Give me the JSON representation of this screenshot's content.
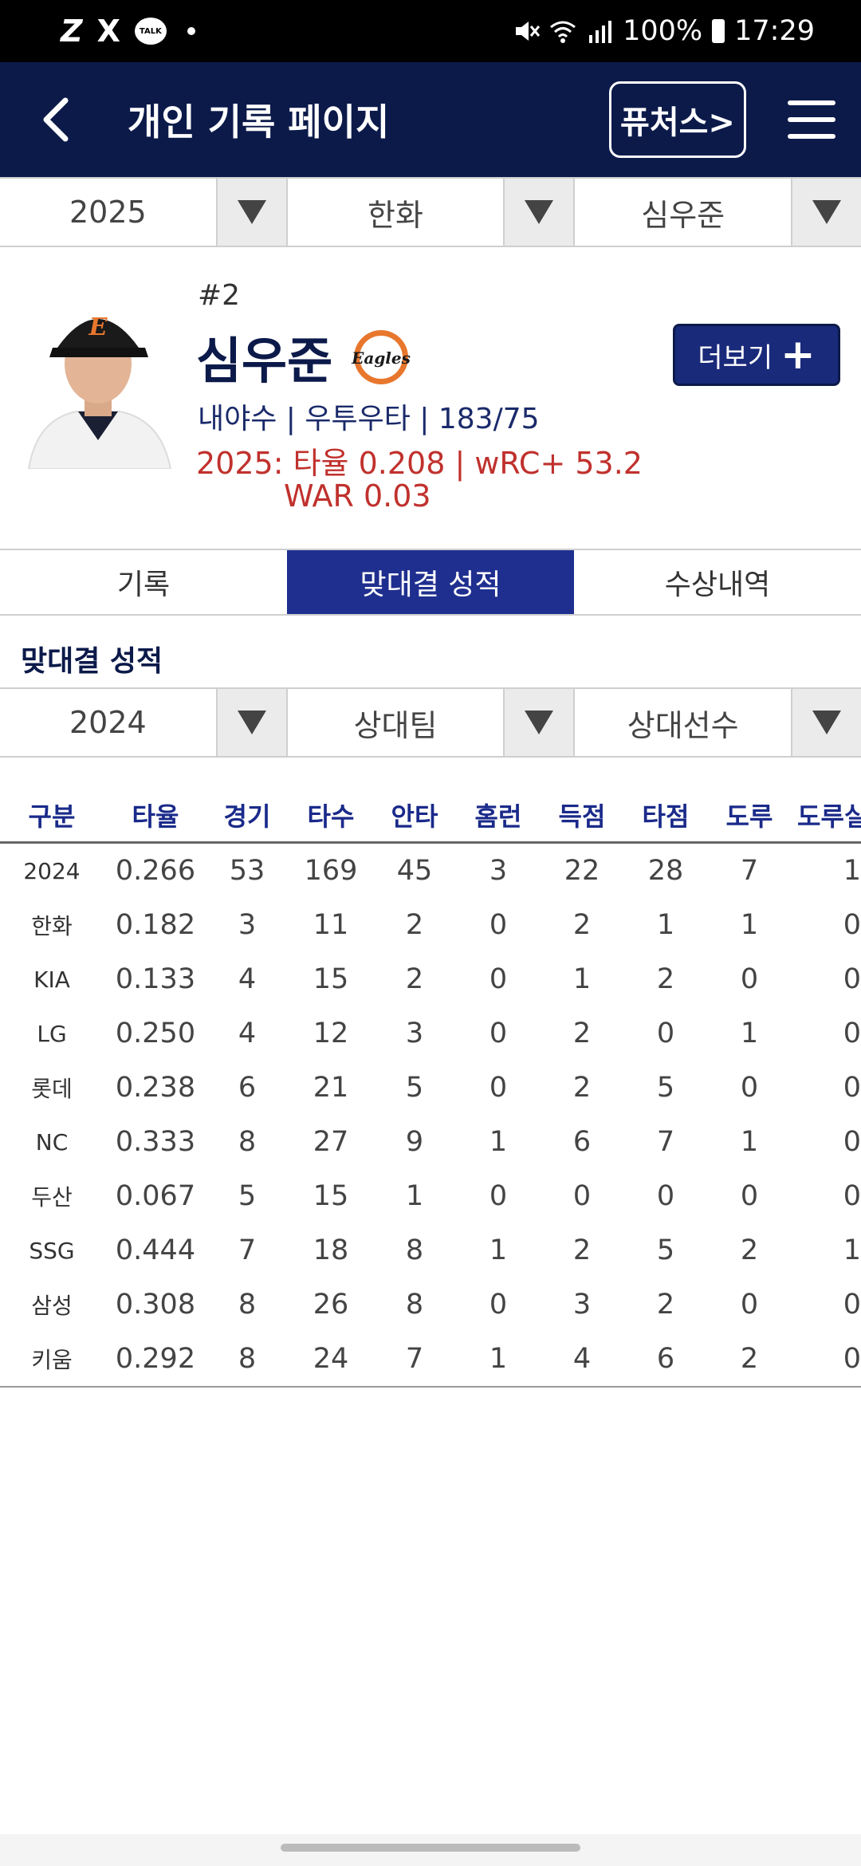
{
  "status_bar": {
    "left_icons": [
      "Z",
      "X",
      "TALK"
    ],
    "battery": "100%",
    "time": "17:29"
  },
  "header": {
    "title": "개인 기록 페이지",
    "futures_label": "퓨처스>"
  },
  "top_selectors": {
    "year": "2025",
    "team": "한화",
    "player": "심우준"
  },
  "player": {
    "number": "#2",
    "name": "심우준",
    "team_logo_text": "Eagles",
    "info": "내야수 | 우투우타 | 183/75",
    "season_stats": "2025: 타율 0.208 | wRC+ 53.2",
    "war": "WAR 0.03",
    "more_label": "더보기"
  },
  "tabs": [
    {
      "label": "기록",
      "active": false
    },
    {
      "label": "맞대결 성적",
      "active": true
    },
    {
      "label": "수상내역",
      "active": false
    }
  ],
  "section_title": "맞대결 성적",
  "matchup_selectors": {
    "year": "2024",
    "opponent_team": "상대팀",
    "opponent_player": "상대선수"
  },
  "table": {
    "headers": [
      "구분",
      "타율",
      "경기",
      "타수",
      "안타",
      "홈런",
      "득점",
      "타점",
      "도루",
      "도루실"
    ],
    "rows": [
      [
        "2024",
        "0.266",
        "53",
        "169",
        "45",
        "3",
        "22",
        "28",
        "7",
        "1"
      ],
      [
        "한화",
        "0.182",
        "3",
        "11",
        "2",
        "0",
        "2",
        "1",
        "1",
        "0"
      ],
      [
        "KIA",
        "0.133",
        "4",
        "15",
        "2",
        "0",
        "1",
        "2",
        "0",
        "0"
      ],
      [
        "LG",
        "0.250",
        "4",
        "12",
        "3",
        "0",
        "2",
        "0",
        "1",
        "0"
      ],
      [
        "롯데",
        "0.238",
        "6",
        "21",
        "5",
        "0",
        "2",
        "5",
        "0",
        "0"
      ],
      [
        "NC",
        "0.333",
        "8",
        "27",
        "9",
        "1",
        "6",
        "7",
        "1",
        "0"
      ],
      [
        "두산",
        "0.067",
        "5",
        "15",
        "1",
        "0",
        "0",
        "0",
        "0",
        "0"
      ],
      [
        "SSG",
        "0.444",
        "7",
        "18",
        "8",
        "1",
        "2",
        "5",
        "2",
        "1"
      ],
      [
        "삼성",
        "0.308",
        "8",
        "26",
        "8",
        "0",
        "3",
        "2",
        "0",
        "0"
      ],
      [
        "키움",
        "0.292",
        "8",
        "24",
        "7",
        "1",
        "4",
        "6",
        "2",
        "0"
      ]
    ]
  },
  "colors": {
    "header_bg": "#0c1a4a",
    "active_tab": "#1f2f8f",
    "accent_red": "#c0312d",
    "header_text": "#1a2a8a"
  }
}
